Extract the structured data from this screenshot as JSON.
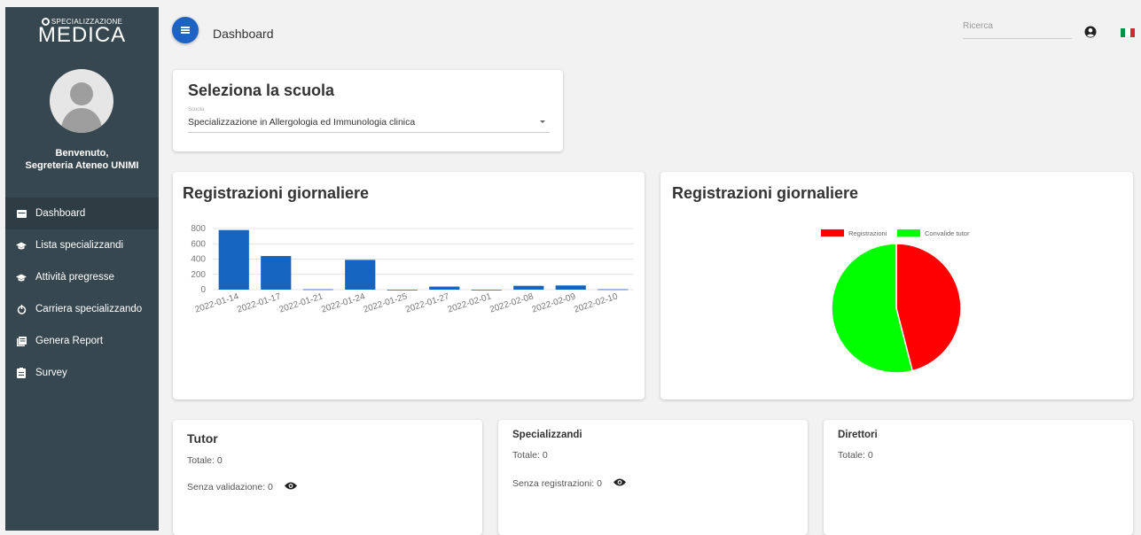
{
  "sidebar": {
    "logo_top": "SPECIALIZZAZIONE",
    "logo_main": "MEDICA",
    "welcome": "Benvenuto,",
    "welcome_name": "Segreteria Ateneo UNIMI",
    "items": [
      {
        "label": "Dashboard",
        "icon": "dashboard-icon",
        "active": true
      },
      {
        "label": "Lista specializzandi",
        "icon": "graduation-cap-icon"
      },
      {
        "label": "Attività pregresse",
        "icon": "graduation-cap-icon"
      },
      {
        "label": "Carriera specializzando",
        "icon": "power-icon"
      },
      {
        "label": "Genera Report",
        "icon": "report-icon"
      },
      {
        "label": "Survey",
        "icon": "clipboard-icon"
      }
    ]
  },
  "header": {
    "title": "Dashboard",
    "search_placeholder": "Ricerca",
    "flag_colors": [
      "#009246",
      "#ffffff",
      "#ce2b37"
    ]
  },
  "school": {
    "title": "Seleziona la scuola",
    "label": "Scuola",
    "value": "Specializzazione in Allergologia ed Immunologia clinica"
  },
  "bar_card": {
    "title": "Registrazioni giornaliere"
  },
  "pie_card": {
    "title": "Registrazioni giornaliere"
  },
  "chart_data": [
    {
      "type": "bar",
      "title": "Registrazioni giornaliere",
      "categories": [
        "2022-01-14",
        "2022-01-17",
        "2022-01-21",
        "2022-01-24",
        "2022-01-25",
        "2022-01-27",
        "2022-02-01",
        "2022-02-08",
        "2022-02-09",
        "2022-02-10"
      ],
      "values": [
        780,
        440,
        5,
        390,
        0,
        40,
        0,
        50,
        55,
        5
      ],
      "ylim": [
        0,
        800
      ],
      "yticks": [
        0,
        200,
        400,
        600,
        800
      ],
      "color": "#1565c0",
      "grid": true
    },
    {
      "type": "pie",
      "title": "Registrazioni giornaliere",
      "labels": [
        "Registrazioni",
        "Convalide tutor"
      ],
      "values": [
        46,
        54
      ],
      "colors": [
        "#ff0000",
        "#00ff00"
      ],
      "legend": "top"
    }
  ],
  "stats": {
    "tutor": {
      "title": "Tutor",
      "total": "Totale: 0",
      "extra": "Senza validazione: 0"
    },
    "specializzandi": {
      "title": "Specializzandi",
      "total": "Totale: 0",
      "extra": "Senza registrazioni: 0"
    },
    "direttori": {
      "title": "Direttori",
      "total": "Totale: 0"
    }
  }
}
